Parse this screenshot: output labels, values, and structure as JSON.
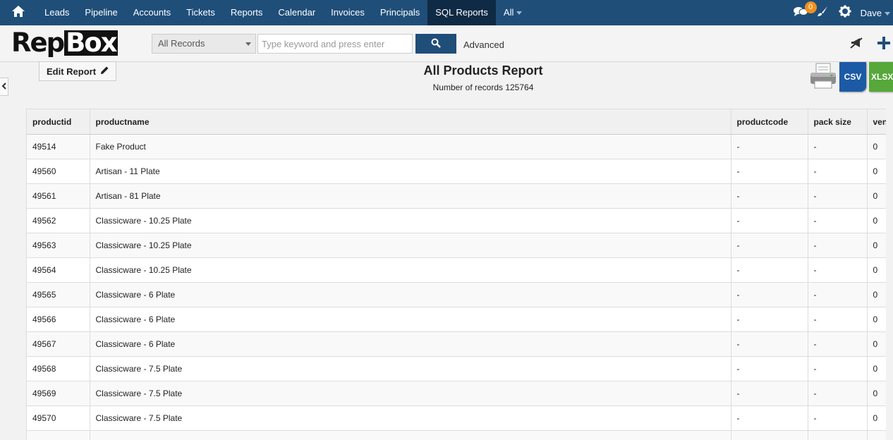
{
  "nav": {
    "items": [
      "Leads",
      "Pipeline",
      "Accounts",
      "Tickets",
      "Reports",
      "Calendar",
      "Invoices",
      "Principals",
      "SQL Reports",
      "All"
    ],
    "active": "SQL Reports",
    "notification_count": "0",
    "user": "Dave"
  },
  "toolbar": {
    "logo_text": "RepBox",
    "record_filter": "All Records",
    "search_placeholder": "Type keyword and press enter",
    "advanced_label": "Advanced"
  },
  "report": {
    "edit_label": "Edit Report",
    "title": "All Products Report",
    "count_text": "Number of records 125764",
    "csv_label": "CSV",
    "xlsx_label": "XLSX"
  },
  "table": {
    "columns": [
      "productid",
      "productname",
      "productcode",
      "pack size",
      "ven"
    ],
    "rows": [
      [
        "49514",
        "Fake Product",
        "-",
        "-",
        "0"
      ],
      [
        "49560",
        "Artisan - 11 Plate",
        "-",
        "-",
        "0"
      ],
      [
        "49561",
        "Artisan - 81 Plate",
        "-",
        "-",
        "0"
      ],
      [
        "49562",
        "Classicware - 10.25 Plate",
        "-",
        "-",
        "0"
      ],
      [
        "49563",
        "Classicware - 10.25 Plate",
        "-",
        "-",
        "0"
      ],
      [
        "49564",
        "Classicware - 10.25 Plate",
        "-",
        "-",
        "0"
      ],
      [
        "49565",
        "Classicware - 6 Plate",
        "-",
        "-",
        "0"
      ],
      [
        "49566",
        "Classicware - 6 Plate",
        "-",
        "-",
        "0"
      ],
      [
        "49567",
        "Classicware - 6 Plate",
        "-",
        "-",
        "0"
      ],
      [
        "49568",
        "Classicware - 7.5 Plate",
        "-",
        "-",
        "0"
      ],
      [
        "49569",
        "Classicware - 7.5 Plate",
        "-",
        "-",
        "0"
      ],
      [
        "49570",
        "Classicware - 7.5 Plate",
        "-",
        "-",
        "0"
      ],
      [
        "",
        "",
        "",
        "",
        ""
      ]
    ]
  },
  "colors": {
    "nav_bg": "#1f4e79",
    "nav_active": "#0f2a44",
    "badge": "#f0901e",
    "csv": "#1c5aa6",
    "xlsx": "#56a83a"
  },
  "icons": {
    "home": "home-icon",
    "chat": "chat-icon",
    "brush": "brush-icon",
    "settings": "gear-icon",
    "search": "search-icon",
    "announce": "megaphone-icon",
    "add": "plus-icon",
    "edit": "pencil-icon",
    "print": "printer-icon",
    "collapse": "chevron-left-icon"
  }
}
